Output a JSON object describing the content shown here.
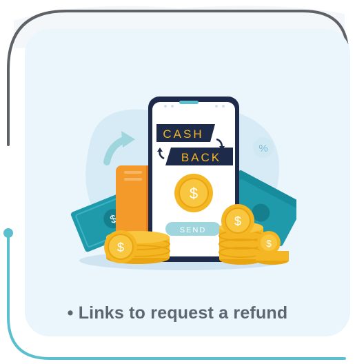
{
  "illustration": {
    "cashback_top": "CASH",
    "cashback_bottom": "BACK",
    "send_button": "SEND",
    "percent_badge": "%",
    "dollar_symbol": "$",
    "icons": [
      "phone-icon",
      "credit-card-icon",
      "banknote-icon",
      "coin-icon",
      "percent-icon",
      "arrow-icon"
    ]
  },
  "caption": {
    "text": "• Links to request a refund"
  },
  "colors": {
    "frame_outline": "#5e6166",
    "accent_teal": "#5bbfcd",
    "card_bg": "#eaf5fc",
    "coin_gold": "#f4b623",
    "bill_teal": "#1f9aab",
    "label_navy": "#1e2a4a",
    "card_orange": "#f39a2b",
    "caption_text": "#5c6570"
  }
}
